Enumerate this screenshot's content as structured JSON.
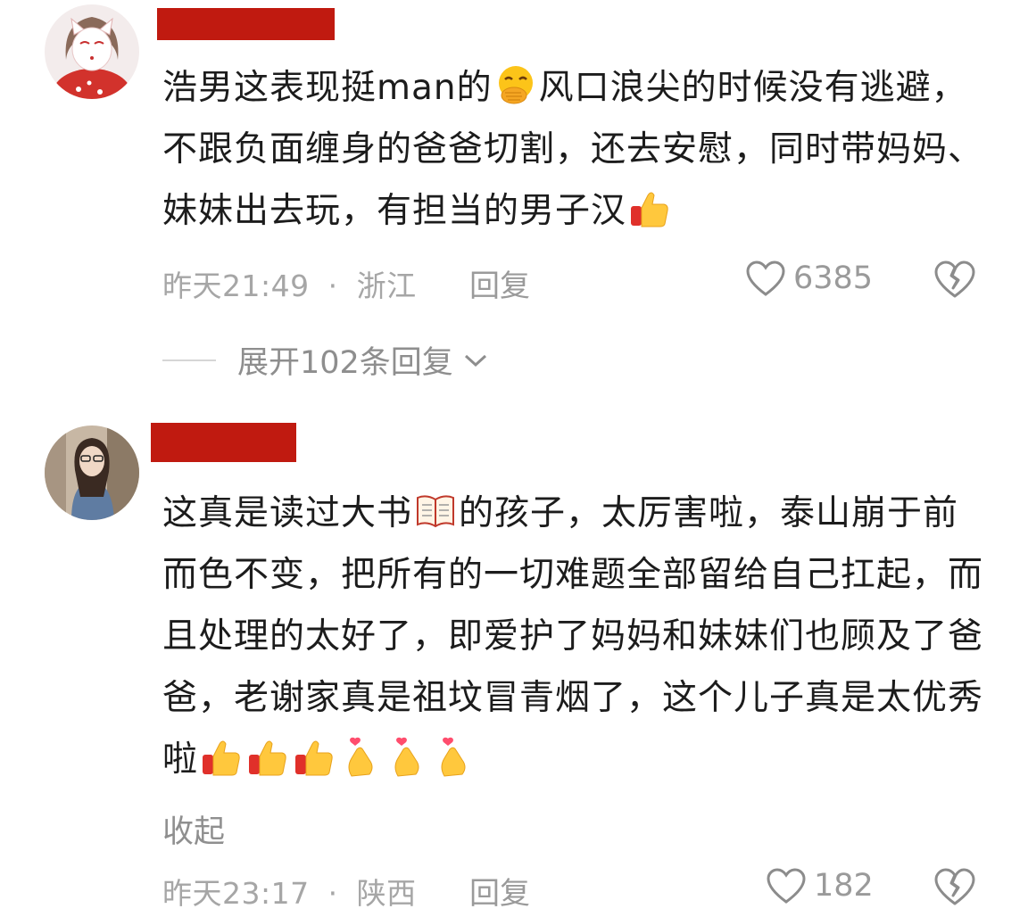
{
  "comments": [
    {
      "text": "浩男这表现挺man的",
      "text_after_emoji1": "风口浪尖的时候没有逃避，不跟负面缠身的爸爸切割，还去安慰，同时带妈妈、妹妹出去玩，有担当的男子汉",
      "time": "昨天21:49",
      "separator": "·",
      "location": "浙江",
      "reply_label": "回复",
      "likes": "6385",
      "expand_label": "展开102条回复",
      "emoji1_icon": "hand-over-mouth-emoji",
      "emoji2_icon": "thumbs-up-emoji"
    },
    {
      "text_part1": "这真是读过大书",
      "text_part2": "的孩子，太厉害啦，泰山崩于前而色不变，把所有的一切难题全部留给自己扛起，而且处理的太好了，即爱护了妈妈和妹妹们也顾及了爸爸，老谢家真是祖坟冒青烟了，这个儿子真是太优秀啦",
      "collapse_label": "收起",
      "time": "昨天23:17",
      "separator": "·",
      "location": "陕西",
      "reply_label": "回复",
      "likes": "182",
      "book_icon": "open-book-emoji",
      "trailing_icons": [
        "thumbs-up-emoji",
        "thumbs-up-emoji",
        "thumbs-up-emoji",
        "finger-heart-emoji",
        "finger-heart-emoji",
        "finger-heart-emoji"
      ]
    }
  ],
  "colors": {
    "redaction": "#c01a10",
    "meta_text": "#a6a6a6",
    "body_text": "#1c1c1c"
  }
}
